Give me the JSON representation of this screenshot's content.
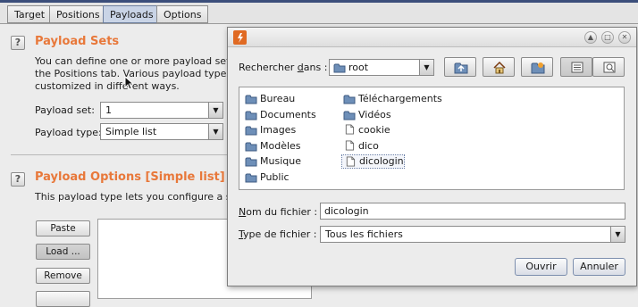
{
  "tabs": [
    {
      "label": "Target"
    },
    {
      "label": "Positions"
    },
    {
      "label": "Payloads"
    },
    {
      "label": "Options"
    }
  ],
  "payload_sets": {
    "title": "Payload Sets",
    "help": "?",
    "line1": "You can define one or more payload sets. T",
    "line2": "the Positions tab. Various payload types ar",
    "line3": "customized in different ways.",
    "set_label": "Payload set:",
    "set_value": "1",
    "type_label": "Payload type:",
    "type_value": "Simple list"
  },
  "payload_options": {
    "title": "Payload Options [Simple list]",
    "help": "?",
    "line1": "This payload type lets you configure a simp",
    "paste_label": "Paste",
    "load_label": "Load ...",
    "remove_label": "Remove"
  },
  "dialog": {
    "look_in_label_pre": "Rechercher ",
    "look_in_label_u": "d",
    "look_in_label_post": "ans :",
    "look_in_value": "root",
    "left_items": [
      {
        "name": "Bureau",
        "kind": "folder"
      },
      {
        "name": "Documents",
        "kind": "folder"
      },
      {
        "name": "Images",
        "kind": "folder"
      },
      {
        "name": "Modèles",
        "kind": "folder"
      },
      {
        "name": "Musique",
        "kind": "folder"
      },
      {
        "name": "Public",
        "kind": "folder"
      }
    ],
    "right_items": [
      {
        "name": "Téléchargements",
        "kind": "folder"
      },
      {
        "name": "Vidéos",
        "kind": "folder"
      },
      {
        "name": "cookie",
        "kind": "file"
      },
      {
        "name": "dico",
        "kind": "file"
      },
      {
        "name": "dicologin",
        "kind": "file"
      }
    ],
    "filename_label_u": "N",
    "filename_label_post": "om du fichier :",
    "filename_value": "dicologin",
    "filetype_label_u": "T",
    "filetype_label_post": "ype de fichier :",
    "filetype_value": "Tous les fichiers",
    "open_label": "Ouvrir",
    "cancel_label": "Annuler"
  }
}
